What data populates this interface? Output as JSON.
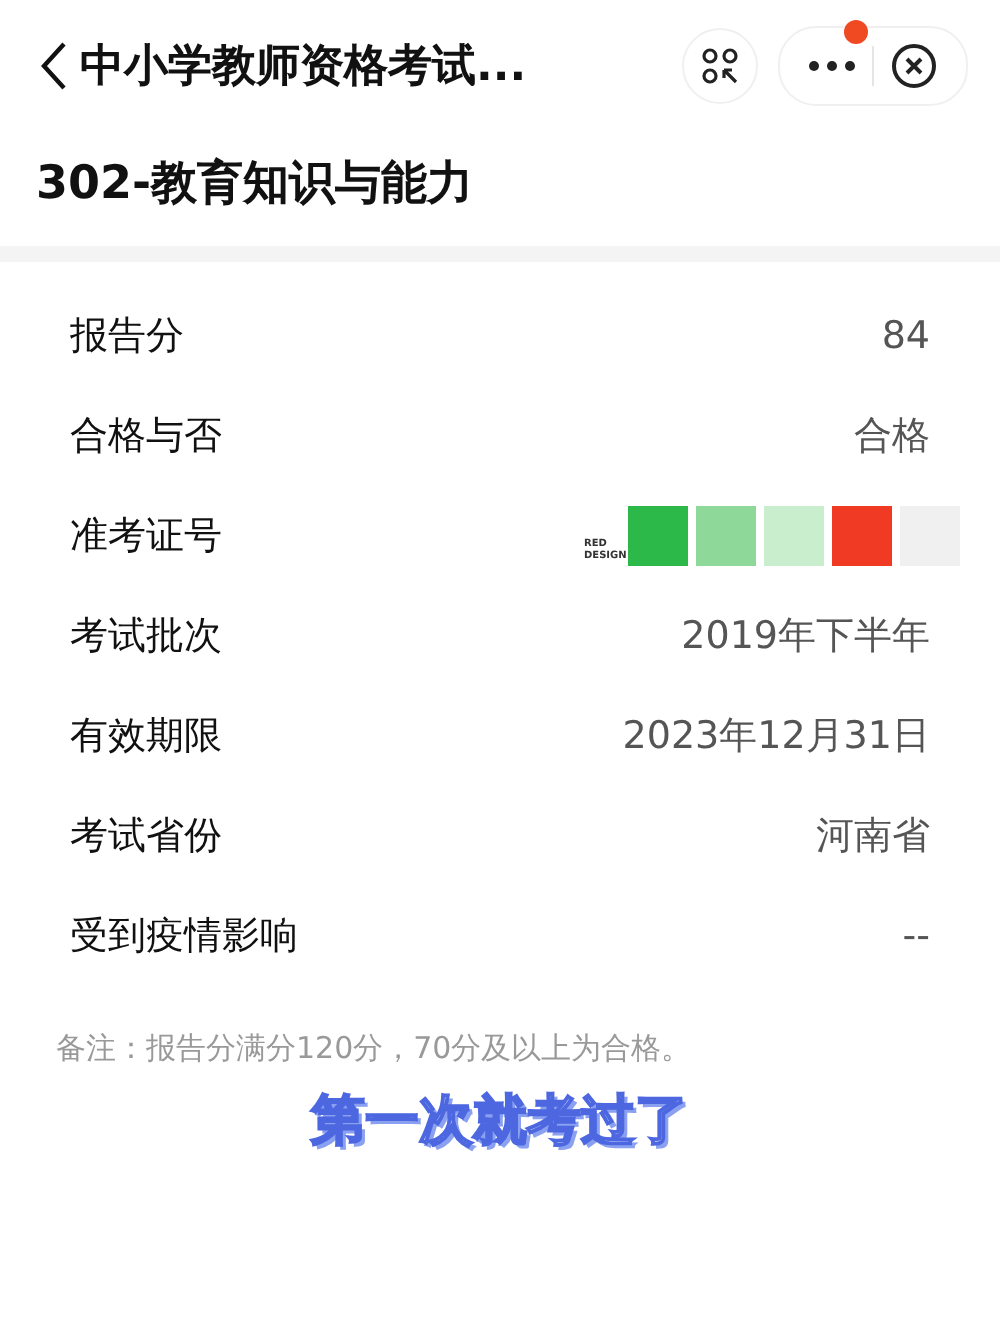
{
  "nav": {
    "title": "中小学教师资格考试...",
    "has_notification": true
  },
  "subject": "302-教育知识与能力",
  "rows": [
    {
      "kind": "text",
      "label": "报告分",
      "value": "84"
    },
    {
      "kind": "text",
      "label": "合格与否",
      "value": "合格"
    },
    {
      "kind": "swatches",
      "label": "准考证号",
      "sticker_label": "RED DESIGN",
      "swatches": [
        {
          "color": "#2db84a"
        },
        {
          "color": "#8ed89a"
        },
        {
          "color": "#c9eecd"
        },
        {
          "color": "#f03a24"
        },
        {
          "color": "#f0f0f0"
        }
      ]
    },
    {
      "kind": "text",
      "label": "考试批次",
      "value": "2019年下半年"
    },
    {
      "kind": "text",
      "label": "有效期限",
      "value": "2023年12月31日"
    },
    {
      "kind": "text",
      "label": "考试省份",
      "value": "河南省"
    },
    {
      "kind": "text",
      "label": "受到疫情影响",
      "value": "--"
    }
  ],
  "note": "备注：报告分满分120分，70分及以上为合格。",
  "caption": "第一次就考过了"
}
